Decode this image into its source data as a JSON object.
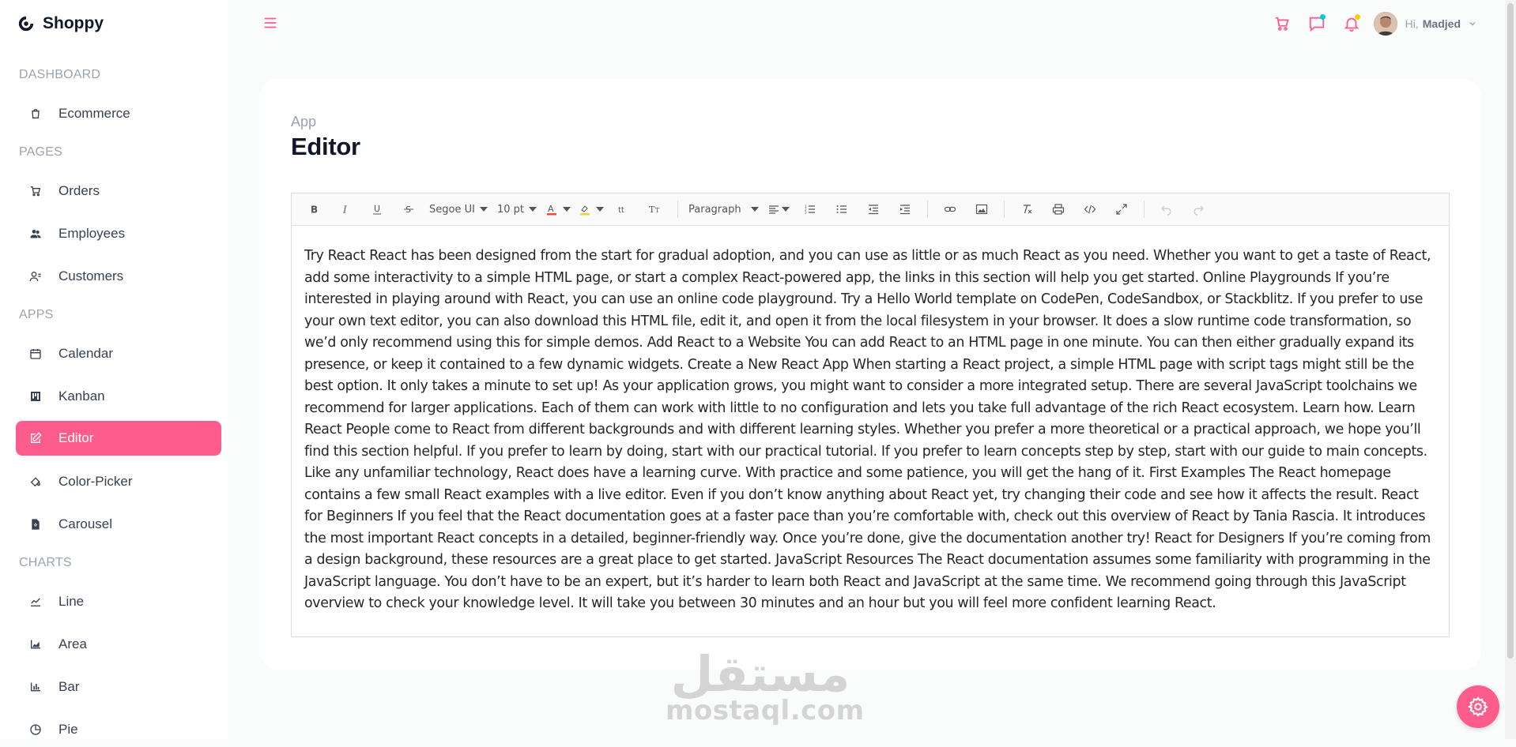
{
  "app": {
    "name": "Shoppy"
  },
  "sidebar": {
    "sections": [
      {
        "label": "DASHBOARD",
        "items": [
          {
            "label": "Ecommerce",
            "icon": "shopping-bag-icon"
          }
        ]
      },
      {
        "label": "PAGES",
        "items": [
          {
            "label": "Orders",
            "icon": "cart-icon"
          },
          {
            "label": "Employees",
            "icon": "people-icon"
          },
          {
            "label": "Customers",
            "icon": "user-group-icon"
          }
        ]
      },
      {
        "label": "APPS",
        "items": [
          {
            "label": "Calendar",
            "icon": "calendar-icon"
          },
          {
            "label": "Kanban",
            "icon": "kanban-icon"
          },
          {
            "label": "Editor",
            "icon": "edit-icon",
            "active": true
          },
          {
            "label": "Color-Picker",
            "icon": "paint-bucket-icon"
          },
          {
            "label": "Carousel",
            "icon": "document-icon"
          }
        ]
      },
      {
        "label": "CHARTS",
        "items": [
          {
            "label": "Line",
            "icon": "line-chart-icon"
          },
          {
            "label": "Area",
            "icon": "area-chart-icon"
          },
          {
            "label": "Bar",
            "icon": "bar-chart-icon"
          },
          {
            "label": "Pie",
            "icon": "pie-chart-icon"
          }
        ]
      }
    ]
  },
  "topbar": {
    "greeting": "Hi,",
    "user_name": "Madjed",
    "icons": [
      "cart-icon",
      "chat-icon",
      "bell-icon"
    ]
  },
  "page": {
    "breadcrumb": "App",
    "title": "Editor"
  },
  "toolbar": {
    "font_family": "Segoe UI",
    "font_size": "10 pt",
    "block_format": "Paragraph"
  },
  "editor": {
    "content": "Try React React has been designed from the start for gradual adoption, and you can use as little or as much React as you need. Whether you want to get a taste of React, add some interactivity to a simple HTML page, or start a complex React-powered app, the links in this section will help you get started. Online Playgrounds If you’re interested in playing around with React, you can use an online code playground. Try a Hello World template on CodePen, CodeSandbox, or Stackblitz. If you prefer to use your own text editor, you can also download this HTML file, edit it, and open it from the local filesystem in your browser. It does a slow runtime code transformation, so we’d only recommend using this for simple demos. Add React to a Website You can add React to an HTML page in one minute. You can then either gradually expand its presence, or keep it contained to a few dynamic widgets. Create a New React App When starting a React project, a simple HTML page with script tags might still be the best option. It only takes a minute to set up! As your application grows, you might want to consider a more integrated setup. There are several JavaScript toolchains we recommend for larger applications. Each of them can work with little to no configuration and lets you take full advantage of the rich React ecosystem. Learn how. Learn React People come to React from different backgrounds and with different learning styles. Whether you prefer a more theoretical or a practical approach, we hope you’ll find this section helpful. If you prefer to learn by doing, start with our practical tutorial. If you prefer to learn concepts step by step, start with our guide to main concepts. Like any unfamiliar technology, React does have a learning curve. With practice and some patience, you will get the hang of it. First Examples The React homepage contains a few small React examples with a live editor. Even if you don’t know anything about React yet, try changing their code and see how it affects the result. React for Beginners If you feel that the React documentation goes at a faster pace than you’re comfortable with, check out this overview of React by Tania Rascia. It introduces the most important React concepts in a detailed, beginner-friendly way. Once you’re done, give the documentation another try! React for Designers If you’re coming from a design background, these resources are a great place to get started. JavaScript Resources The React documentation assumes some familiarity with programming in the JavaScript language. You don’t have to be an expert, but it’s harder to learn both React and JavaScript at the same time. We recommend going through this JavaScript overview to check your knowledge level. It will take you between 30 minutes and an hour but you will feel more confident learning React."
  },
  "watermark": {
    "arabic": "مستقل",
    "latin": "mostaql.com"
  },
  "colors": {
    "accent": "#ff5c8e",
    "chat_dot": "#03c9d7",
    "bell_dot": "#fec90f"
  }
}
